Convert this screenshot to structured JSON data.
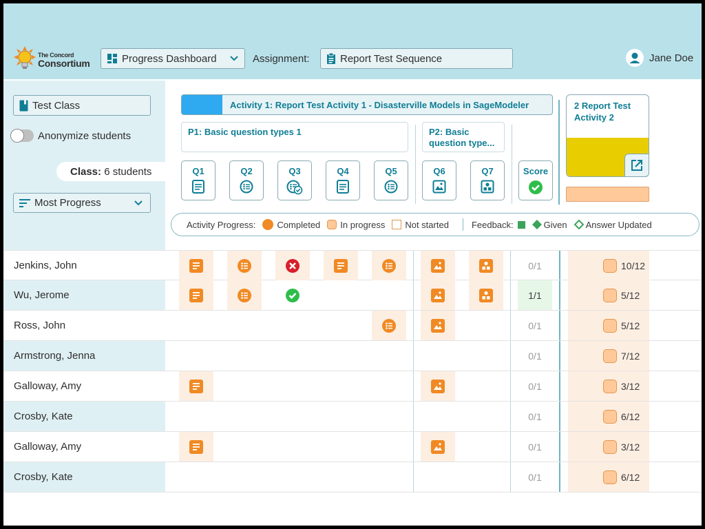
{
  "header": {
    "logo_line1": "The Concord",
    "logo_line2": "Consortium",
    "dashboard_select": "Progress Dashboard",
    "assignment_label": "Assignment:",
    "assignment_value": "Report Test Sequence",
    "user_name": "Jane Doe"
  },
  "sidebar": {
    "class_button": "Test Class",
    "anonymize_label": "Anonymize students",
    "class_count_label": "Class:",
    "class_count_value": "6 students",
    "sort_select": "Most Progress"
  },
  "activity1": {
    "title": "Activity 1: Report Test Activity 1 - Disasterville Models in SageModeler",
    "progress_fraction": 0.11,
    "page1": "P1: Basic question types 1",
    "page2": "P2: Basic question type...",
    "questions": [
      "Q1",
      "Q2",
      "Q3",
      "Q4",
      "Q5",
      "Q6",
      "Q7"
    ],
    "score_label": "Score"
  },
  "activity2": {
    "title": "2 Report Test Activity 2"
  },
  "legend": {
    "activity_progress_label": "Activity Progress:",
    "completed": "Completed",
    "in_progress": "In progress",
    "not_started": "Not started",
    "feedback_label": "Feedback:",
    "given": "Given",
    "answer_updated": "Answer Updated"
  },
  "colors": {
    "header_band": "#b9e1ea",
    "accent_teal": "#0f7e95",
    "orange": "#f08a24",
    "peach": "#ffc99a",
    "green": "#2ebd4a",
    "red": "#d81e2c",
    "yellow": "#e8cd00"
  },
  "students": [
    {
      "name": "Jenkins, John",
      "score": "0/1",
      "progress": "10/12"
    },
    {
      "name": "Wu, Jerome",
      "score": "1/1",
      "progress": "5/12"
    },
    {
      "name": "Ross, John",
      "score": "0/1",
      "progress": "5/12"
    },
    {
      "name": "Armstrong, Jenna",
      "score": "0/1",
      "progress": "7/12"
    },
    {
      "name": "Galloway, Amy",
      "score": "0/1",
      "progress": "3/12"
    },
    {
      "name": "Crosby, Kate",
      "score": "0/1",
      "progress": "6/12"
    },
    {
      "name": "Galloway, Amy",
      "score": "0/1",
      "progress": "3/12"
    },
    {
      "name": "Crosby, Kate",
      "score": "0/1",
      "progress": "6/12"
    }
  ]
}
